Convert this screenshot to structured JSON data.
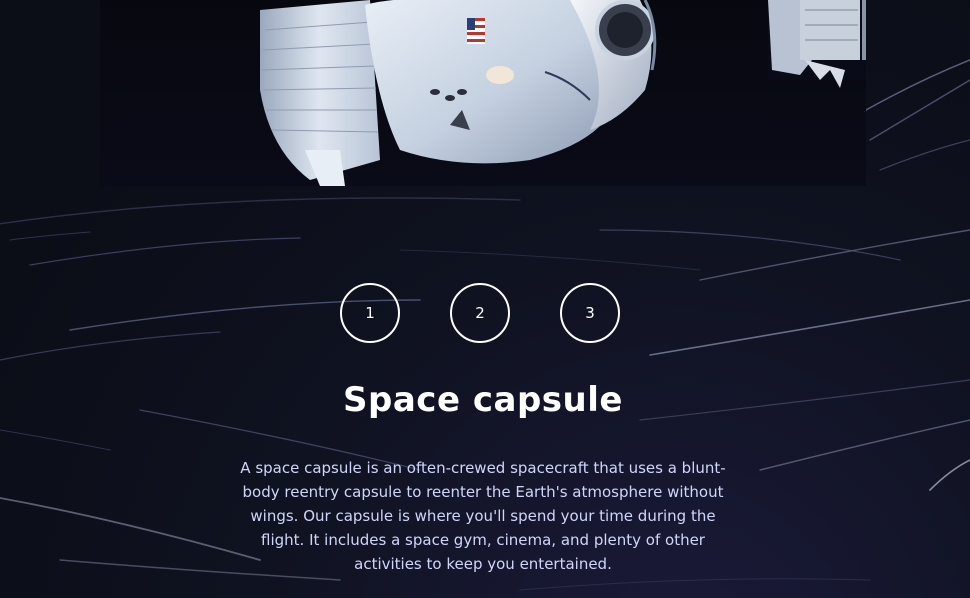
{
  "page": {
    "hero_image": {
      "alt": "Space capsule docking",
      "flag": "flag-icon"
    },
    "steps": [
      {
        "label": "1",
        "active": false
      },
      {
        "label": "2",
        "active": false
      },
      {
        "label": "3",
        "active": false
      }
    ],
    "title": "Space capsule",
    "description": "A space capsule is an often-crewed spacecraft that uses a blunt-body reentry capsule to reenter the Earth's atmosphere without wings. Our capsule is where you'll spend your time during the flight. It includes a space gym, cinema, and plenty of other activities to keep you entertained."
  },
  "colors": {
    "background": "#0b0d17",
    "text": "#ffffff",
    "body_text": "#d0d6f9"
  }
}
